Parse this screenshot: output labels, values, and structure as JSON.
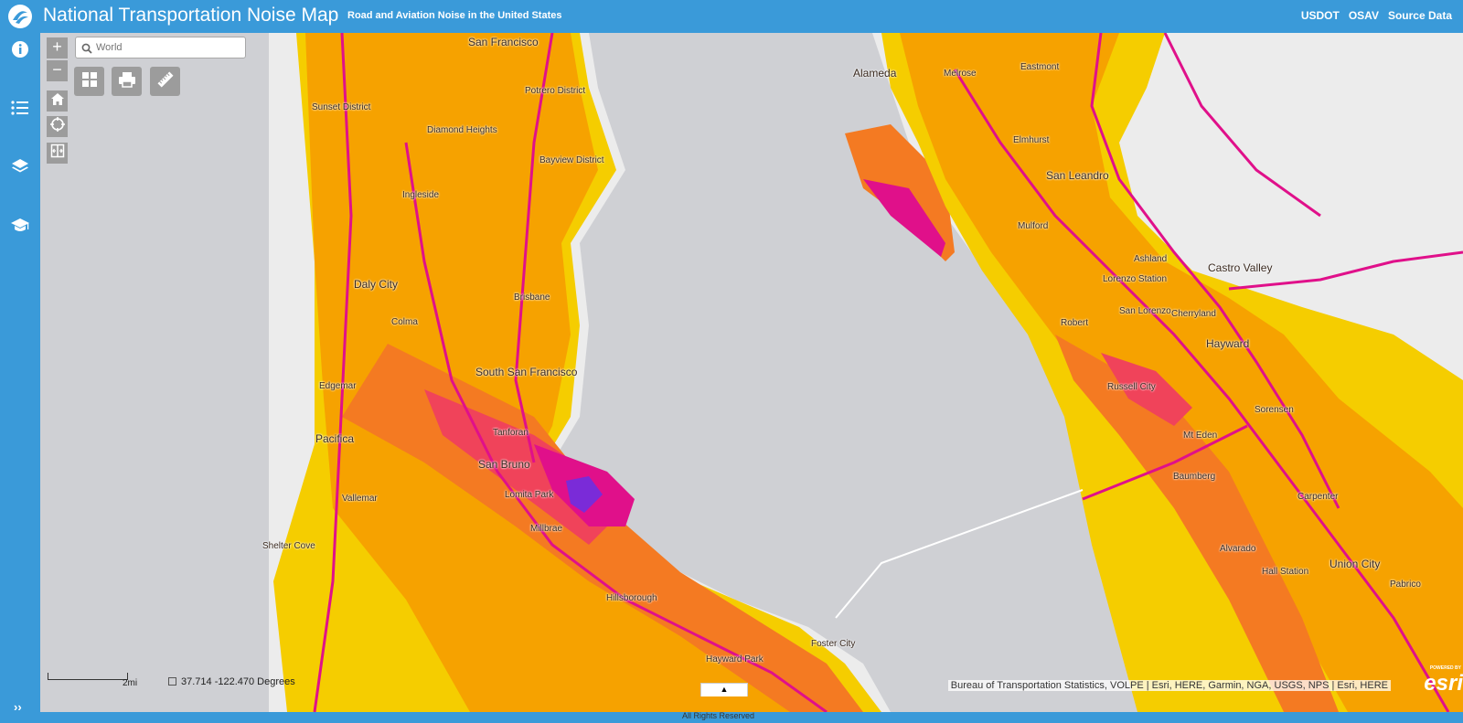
{
  "header": {
    "title": "National Transportation Noise Map",
    "subtitle": "Road and Aviation Noise in the United States",
    "links": [
      "USDOT",
      "OSAV",
      "Source Data"
    ]
  },
  "sidebar": {
    "icons": [
      "info-icon",
      "list-icon",
      "layers-icon",
      "education-icon"
    ],
    "expand_label": "››"
  },
  "map": {
    "search_placeholder": "World",
    "zoom_in": "+",
    "zoom_out": "−",
    "place_labels": [
      "San Francisco",
      "Potrero District",
      "Sunset District",
      "Diamond Heights",
      "Bayview District",
      "Ingleside",
      "Alameda",
      "Melrose",
      "Eastmont",
      "Elmhurst",
      "San Leandro",
      "Mulford",
      "Ashland",
      "Castro Valley",
      "Lorenzo Station",
      "San Lorenzo",
      "Cherryland",
      "Robert",
      "Hayward",
      "Russell City",
      "Sorensen",
      "Mt Eden",
      "Baumberg",
      "Carpenter",
      "Alvarado",
      "Hall Station",
      "Union City",
      "Pabrico",
      "Daly City",
      "Colma",
      "Brisbane",
      "South San Francisco",
      "Tanforan",
      "San Bruno",
      "Lomita Park",
      "Millbrae",
      "Edgemar",
      "Pacifica",
      "Vallemar",
      "Shelter Cove",
      "Hillsborough",
      "Hayward Park",
      "Foster City"
    ],
    "scale_label": "2mi",
    "coordinates": "37.714  -122.470 Degrees",
    "attribution": "Bureau of Transportation Statistics, VOLPE | Esri, HERE, Garmin, NGA, USGS, NPS | Esri, HERE",
    "esri_powered": "POWERED BY",
    "esri_name": "esri",
    "tab_arrow": "▲"
  },
  "footer": {
    "text": "All Rights Reserved"
  },
  "colors": {
    "header_bg": "#3a9ad9",
    "water": "#cfd0d4",
    "land": "#ececec",
    "noise_low": "#f5cd00",
    "noise_mid": "#f6a200",
    "noise_high": "#f47a22",
    "noise_very_high": "#f0435a",
    "noise_extreme": "#e0108a",
    "noise_peak": "#7a2bd8"
  }
}
